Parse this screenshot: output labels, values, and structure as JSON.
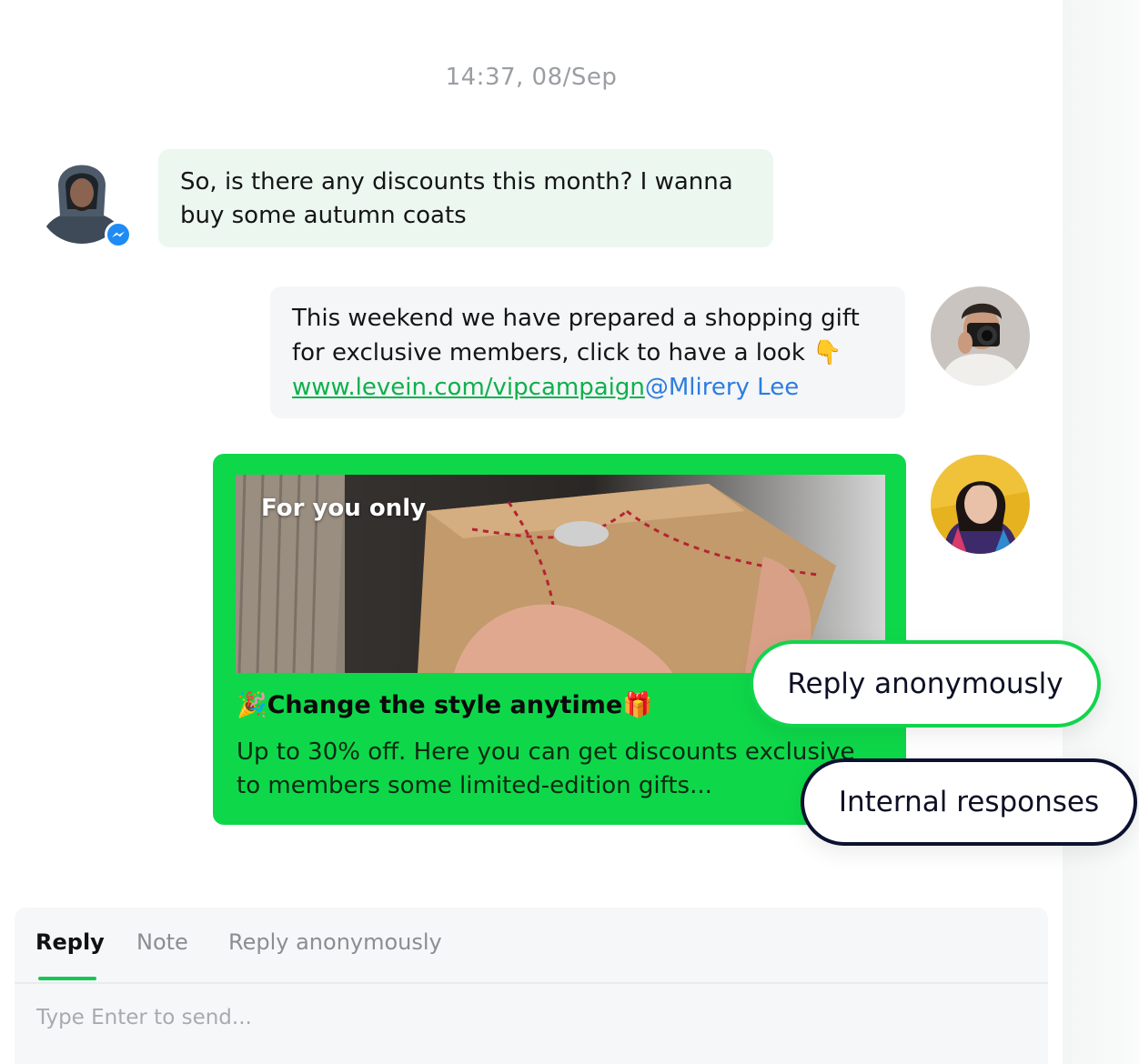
{
  "timestamp": "14:37, 08/Sep",
  "conversation": {
    "incoming": {
      "text": "So, is there any discounts this month? I wanna buy some autumn coats",
      "channel_badge": "messenger-icon"
    },
    "outgoing_text": {
      "text": "This weekend we have prepared a shopping gift for exclusive members, click to have a look 👇",
      "link": "www.levein.com/vipcampaign",
      "mention": "@Mlirery Lee"
    },
    "card": {
      "image_label": "For you only",
      "title": "🎉Change the style anytime🎁",
      "description": "Up to 30% off. Here you can get discounts exclusive to members some limited-edition gifts..."
    }
  },
  "floating_labels": {
    "reply_anonymously": "Reply anonymously",
    "internal_responses": "Internal responses"
  },
  "composer": {
    "tabs": [
      {
        "label": "Reply",
        "active": true
      },
      {
        "label": "Note",
        "active": false
      },
      {
        "label": "Reply anonymously",
        "active": false
      }
    ],
    "placeholder": "Type Enter to send..."
  },
  "colors": {
    "accent": "#0ed84a",
    "incoming_bubble": "#ecf7f0",
    "outgoing_bubble": "#f5f6f7",
    "link": "#0db14b",
    "mention": "#2d7de0"
  }
}
